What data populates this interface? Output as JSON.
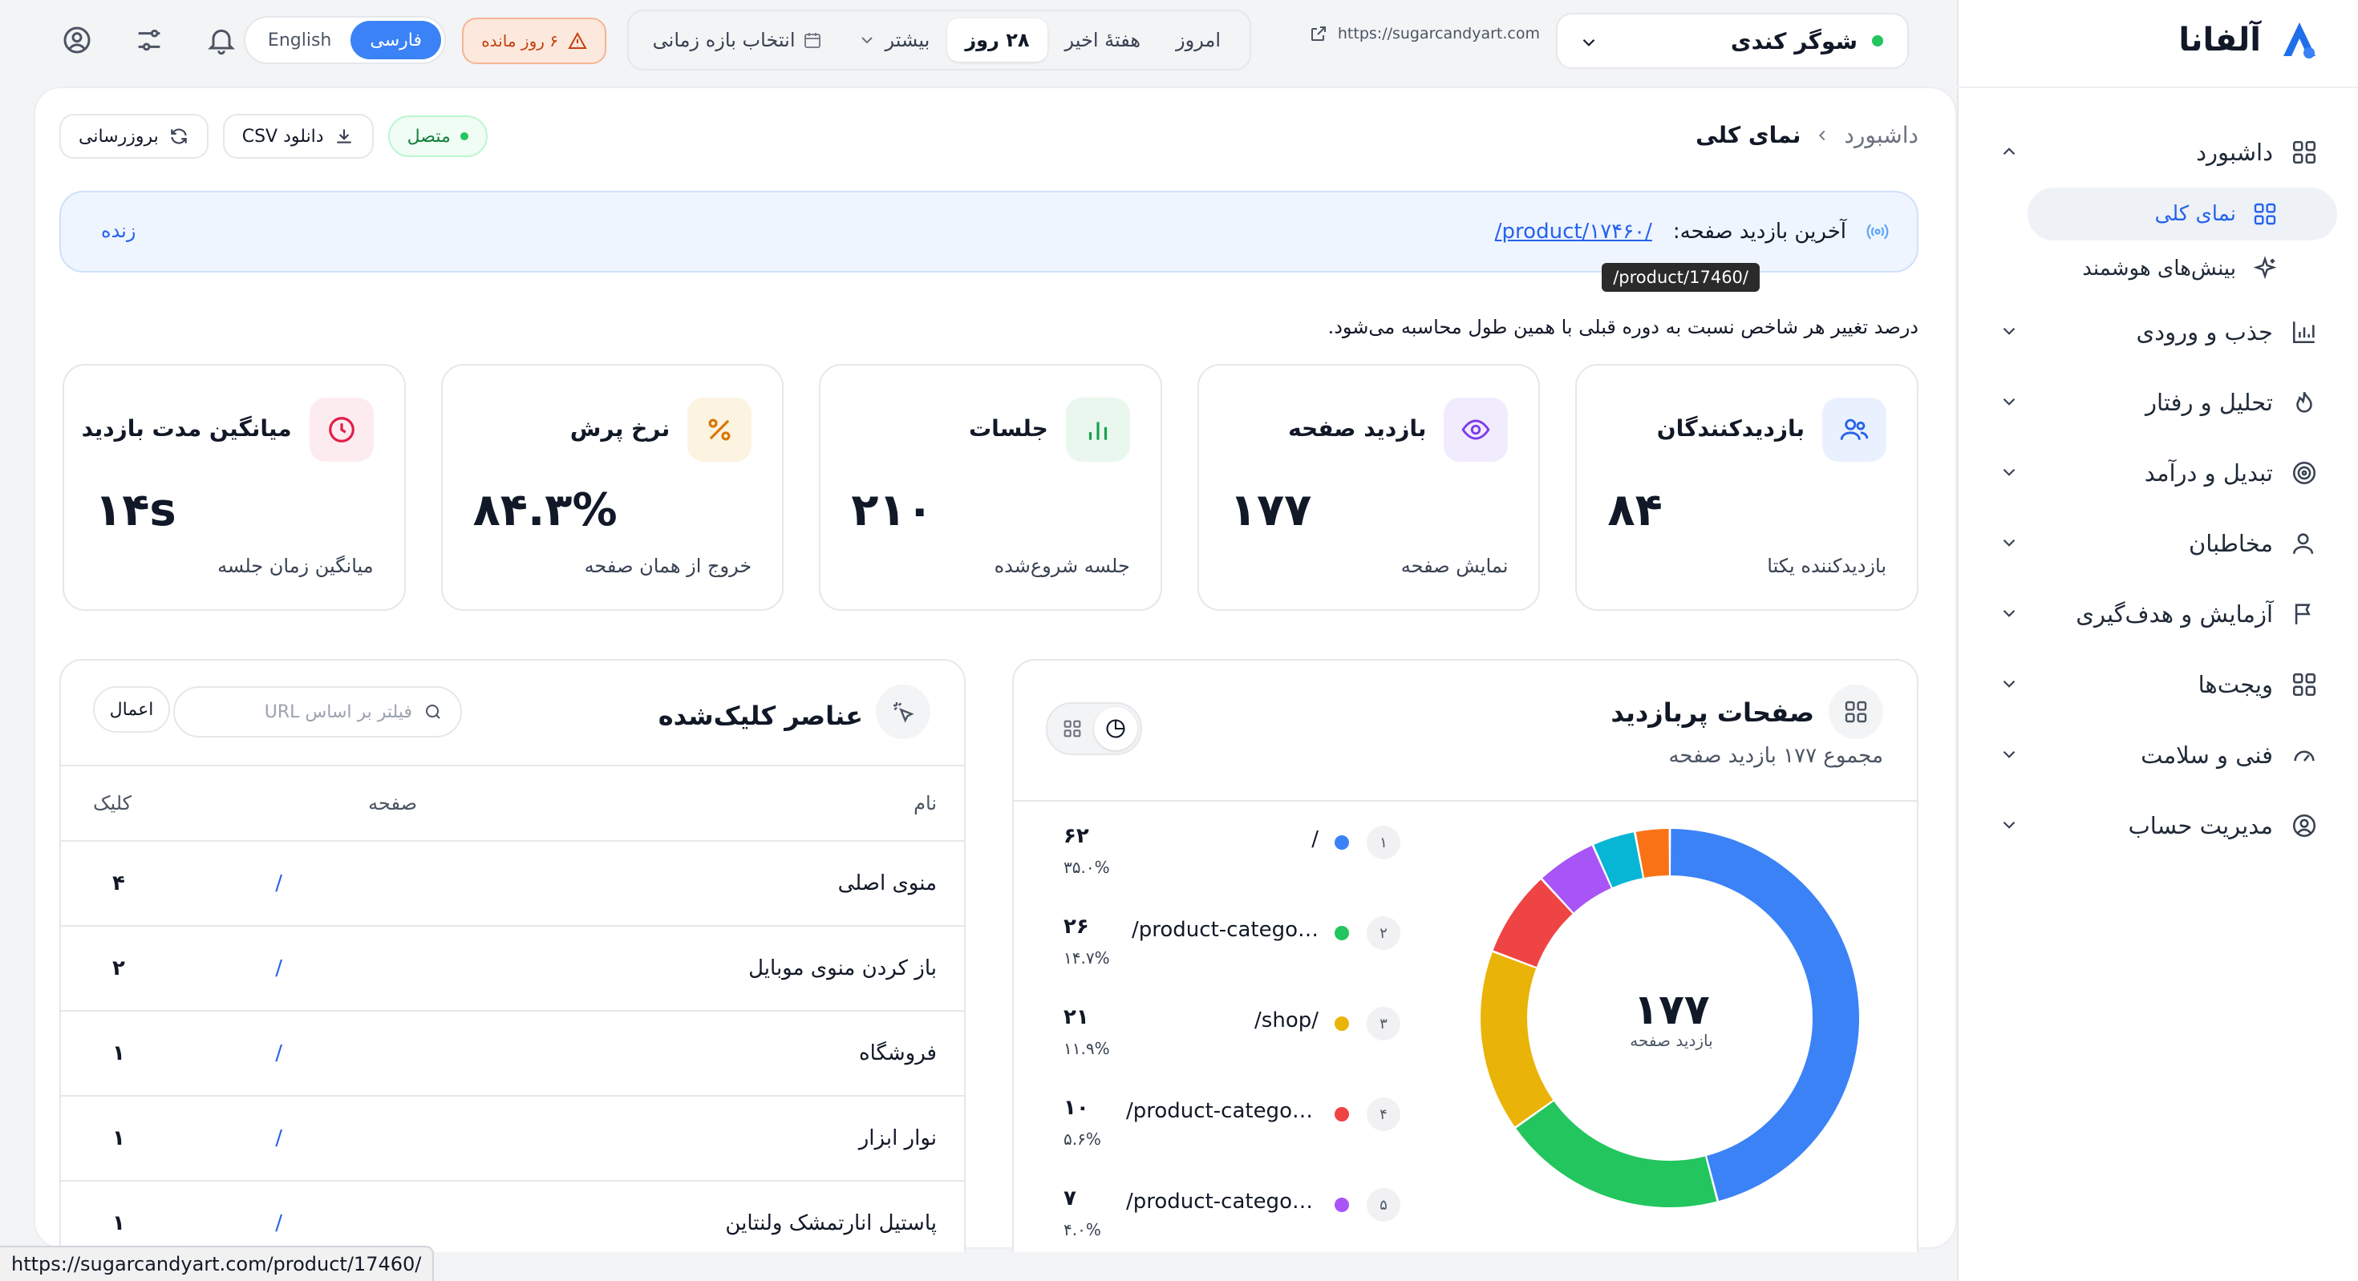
{
  "app": {
    "name": "آلفانا"
  },
  "colors": {
    "accent": "#3b82f6",
    "bg": "#f3f4f6",
    "success": "#22c55e",
    "warning": "#ea580c"
  },
  "sidebar": {
    "groups": [
      {
        "label": "داشبورد",
        "icon": "dashboard-icon",
        "expanded": true,
        "items": [
          {
            "label": "نمای کلی",
            "icon": "grid-icon",
            "active": true
          },
          {
            "label": "بینش‌های هوشمند",
            "icon": "sparkle-icon",
            "active": false
          }
        ]
      },
      {
        "label": "جذب و ورودی",
        "icon": "bar-chart-icon"
      },
      {
        "label": "تحلیل و رفتار",
        "icon": "flame-icon"
      },
      {
        "label": "تبدیل و درآمد",
        "icon": "target-icon"
      },
      {
        "label": "مخاطبان",
        "icon": "user-icon"
      },
      {
        "label": "آزمایش و هدف‌گیری",
        "icon": "flag-icon"
      },
      {
        "label": "ویجت‌ها",
        "icon": "widgets-icon"
      },
      {
        "label": "فنی و سلامت",
        "icon": "gauge-icon"
      },
      {
        "label": "مدیریت حساب",
        "icon": "account-icon"
      }
    ]
  },
  "topbar": {
    "site_name": "شوگر کندی",
    "site_url": "https://sugarcandyart.com",
    "ranges": [
      "امروز",
      "هفتهٔ اخیر",
      "۲۸ روز",
      "بیشتر",
      "انتخاب بازه زمانی"
    ],
    "active_range": "۲۸ روز",
    "trial": "۶ روز مانده",
    "lang": {
      "fa": "فارسی",
      "en": "English",
      "active": "fa"
    }
  },
  "header": {
    "breadcrumb_root": "داشبورد",
    "breadcrumb_current": "نمای کلی",
    "status": "متصل",
    "download": "دانلود CSV",
    "refresh": "بروزرسانی"
  },
  "live": {
    "label": "آخرین بازدید صفحه:",
    "link": "/product/۱۷۴۶۰/",
    "tag": "زنده",
    "tooltip": "/product/17460/"
  },
  "note": "درصد تغییر هر شاخص نسبت به دوره قبلی با همین طول محاسبه می‌شود.",
  "kpis": [
    {
      "title": "بازدیدکنندگان",
      "value": "۸۴",
      "sub": "بازدیدکننده یکتا",
      "icon": "users-icon",
      "color": "#2563eb",
      "bg": "#eaf1fe"
    },
    {
      "title": "بازدید صفحه",
      "value": "۱۷۷",
      "sub": "نمایش صفحه",
      "icon": "eye-icon",
      "color": "#7c3aed",
      "bg": "#f1ecfd"
    },
    {
      "title": "جلسات",
      "value": "۲۱۰",
      "sub": "جلسه شروع‌شده",
      "icon": "bar-chart-icon",
      "color": "#16a34a",
      "bg": "#eaf7ee"
    },
    {
      "title": "نرخ پرش",
      "value": "۸۴.۳%",
      "sub": "خروج از همان صفحه",
      "icon": "percent-icon",
      "color": "#d97706",
      "bg": "#fdf3e1"
    },
    {
      "title": "میانگین مدت بازدید",
      "value": "۱۴s",
      "sub": "میانگین زمان جلسه",
      "icon": "clock-icon",
      "color": "#e11d48",
      "bg": "#fdecef"
    }
  ],
  "top_pages": {
    "title": "صفحات پربازدید",
    "subtitle": "مجموع ۱۷۷ بازدید صفحه",
    "total": "۱۷۷",
    "total_label": "بازدید صفحه",
    "legend": [
      {
        "rank": "۱",
        "path": "/",
        "count": "۶۲",
        "pct": "۳۵.۰%",
        "color": "#3b82f6"
      },
      {
        "rank": "۲",
        "path": "/product-catego…",
        "count": "۲۶",
        "pct": "۱۴.۷%",
        "color": "#22c55e"
      },
      {
        "rank": "۳",
        "path": "/shop/",
        "count": "۲۱",
        "pct": "۱۱.۹%",
        "color": "#eab308"
      },
      {
        "rank": "۴",
        "path": "/product-categor…",
        "count": "۱۰",
        "pct": "۵.۶%",
        "color": "#ef4444"
      },
      {
        "rank": "۵",
        "path": "/product-categor…",
        "count": "۷",
        "pct": "۴.۰%",
        "color": "#a855f7"
      }
    ]
  },
  "chart_data": {
    "type": "pie",
    "values": [
      62,
      26,
      21,
      10,
      7,
      5,
      4
    ],
    "colors": [
      "#3b82f6",
      "#22c55e",
      "#eab308",
      "#ef4444",
      "#a855f7",
      "#06b6d4",
      "#f97316"
    ]
  },
  "clicks": {
    "title": "عناصر کلیک‌شده",
    "filter_placeholder": "فیلتر بر اساس URL",
    "apply": "اعمال",
    "columns": {
      "name": "نام",
      "page": "صفحه",
      "clicks": "کلیک"
    },
    "rows": [
      {
        "name": "منوی اصلی",
        "page": "/",
        "clicks": "۴"
      },
      {
        "name": "باز کردن منوی موبایل",
        "page": "/",
        "clicks": "۲"
      },
      {
        "name": "فروشگاه",
        "page": "/",
        "clicks": "۱"
      },
      {
        "name": "نوار ابزار",
        "page": "/",
        "clicks": "۱"
      },
      {
        "name": "پاستیل انارتمشک ولنتاین",
        "page": "/",
        "clicks": "۱"
      }
    ]
  },
  "status_url": "https://sugarcandyart.com/product/17460/"
}
